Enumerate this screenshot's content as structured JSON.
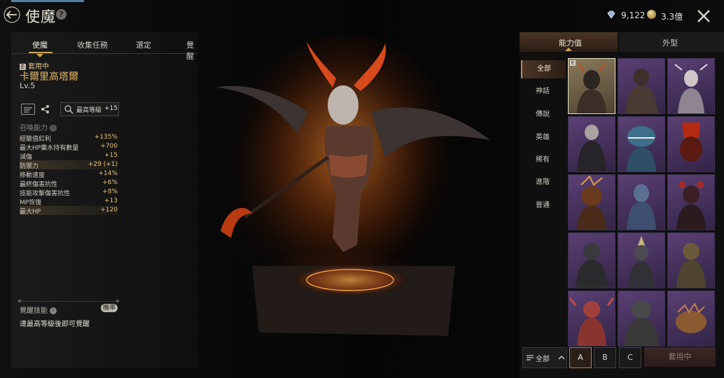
{
  "header": {
    "title": "使魔",
    "gems": "9,122",
    "coins": "3.3億"
  },
  "left_tabs": [
    "使魔",
    "收集任務",
    "選定",
    "覺醒"
  ],
  "familiar": {
    "equip_badge": "E",
    "equip_status": "套用中",
    "name": "卡爾里高塔爾",
    "level": "Lv.5"
  },
  "max_level_btn": {
    "label": "最高等級",
    "value": "+15"
  },
  "summon": {
    "title": "召喚能力",
    "stats": [
      {
        "label": "經驗值紅利",
        "value": "+135%",
        "highlight": false
      },
      {
        "label": "最大HP藥水持有數量",
        "value": "+700",
        "highlight": false
      },
      {
        "label": "減傷",
        "value": "+15",
        "highlight": false
      },
      {
        "label": "防禦力",
        "value": "+29 (+1)",
        "highlight": true
      },
      {
        "label": "移動速度",
        "value": "+14%",
        "highlight": false
      },
      {
        "label": "最終傷害抗性",
        "value": "+6%",
        "highlight": false
      },
      {
        "label": "技能攻擊傷害抗性",
        "value": "+8%",
        "highlight": false
      },
      {
        "label": "MP恢復",
        "value": "+13",
        "highlight": false
      },
      {
        "label": "最大HP",
        "value": "+120",
        "highlight": true
      }
    ]
  },
  "awaken": {
    "label": "覺醒技能",
    "badge": "機率",
    "note": "達最高等級後即可覺醒"
  },
  "right_tabs": [
    "能力值",
    "外型"
  ],
  "categories": [
    "全部",
    "神話",
    "傳說",
    "英雄",
    "稀有",
    "進階",
    "普通"
  ],
  "grid": {
    "equipped_badge": "E"
  },
  "bottom": {
    "filter_label": "全部",
    "presets": [
      "A",
      "B",
      "C"
    ],
    "apply_label": "套用中"
  },
  "colors": {
    "accent_gold": "#c9a55b",
    "name_gold": "#e7b867",
    "stat_value": "#e9c17a",
    "cell_purple": "#5a4074"
  }
}
